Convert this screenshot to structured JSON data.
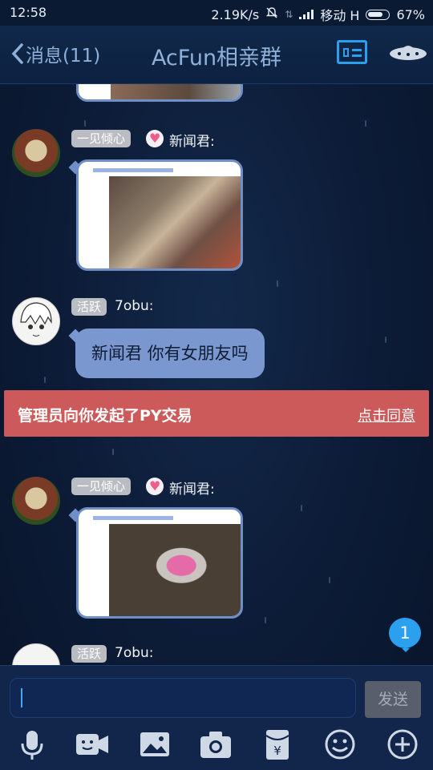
{
  "status_bar": {
    "time": "12:58",
    "net_speed": "2.19K/s",
    "carrier": "移动 H",
    "battery": "67%"
  },
  "header": {
    "back_label": "消息(11)",
    "title": "AcFun相亲群"
  },
  "messages": [
    {
      "badge": "一见倾心",
      "sender": "新闻君:",
      "type": "image"
    },
    {
      "badge": "活跃",
      "sender": "7obu:",
      "type": "text",
      "text": "新闻君 你有女朋友吗"
    },
    {
      "badge": "一见倾心",
      "sender": "新闻君:",
      "type": "image"
    },
    {
      "badge": "活跃",
      "sender": "7obu:",
      "type": "partial"
    }
  ],
  "banner": {
    "message": "管理员向你发起了PY交易",
    "action": "点击同意"
  },
  "unread_count": "1",
  "input": {
    "value": "",
    "send_label": "发送"
  },
  "toolbar": [
    "microphone-icon",
    "video-chat-icon",
    "image-icon",
    "camera-icon",
    "red-packet-icon",
    "emoji-icon",
    "add-icon"
  ],
  "colors": {
    "background": "#0c1b36",
    "accent": "#2aa0ee",
    "bubble": "#7a97cf",
    "banner": "#cc5a5a"
  }
}
